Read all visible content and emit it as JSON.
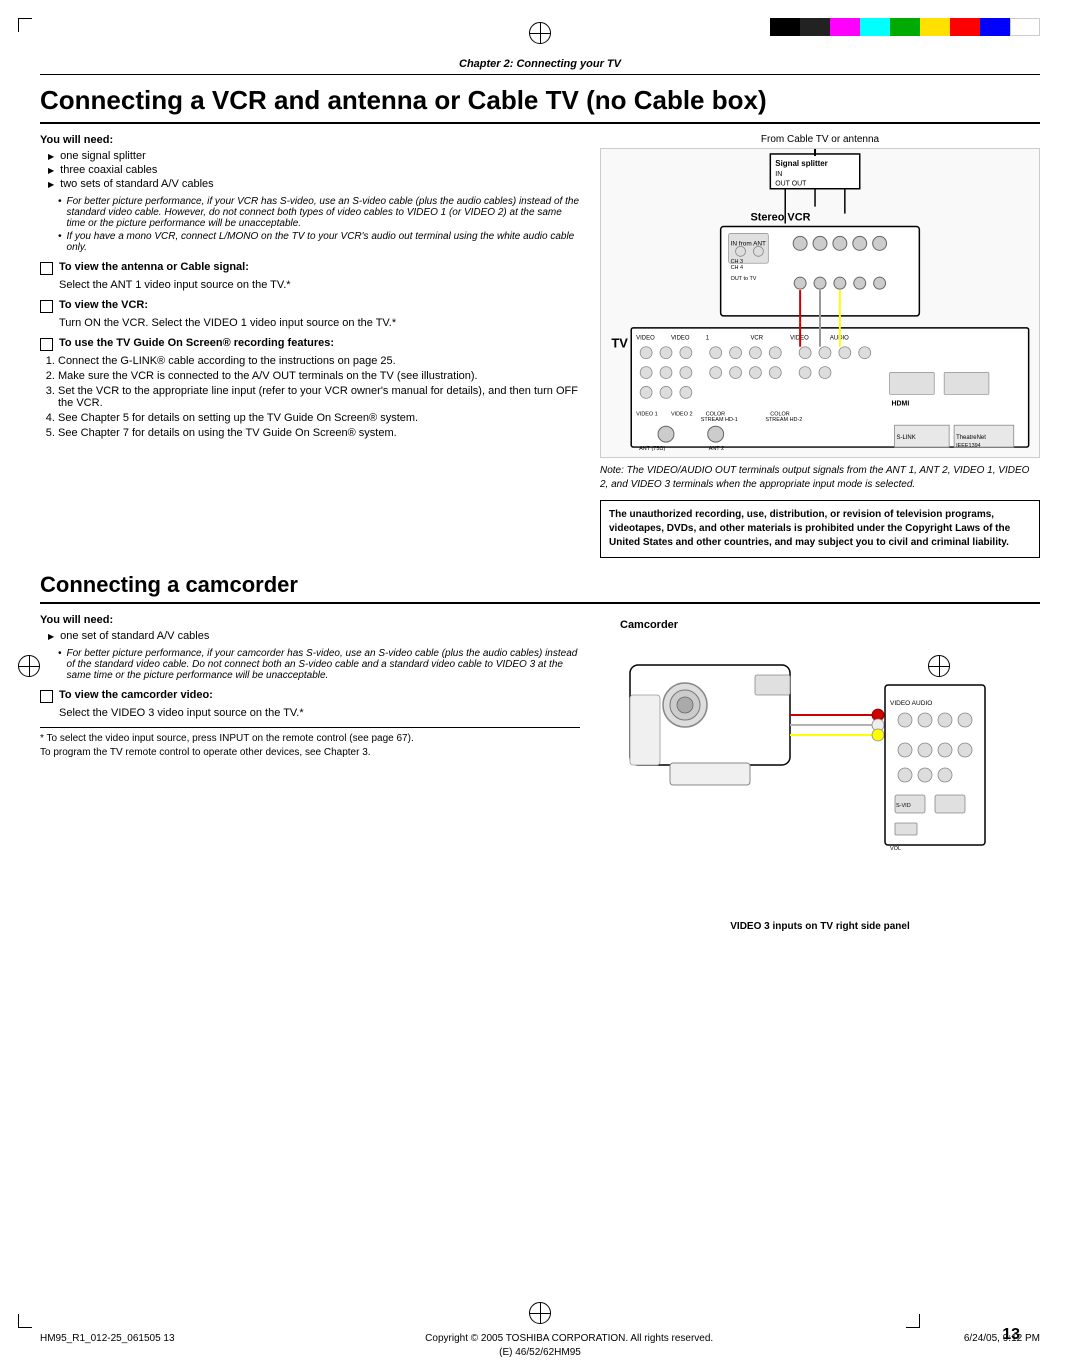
{
  "page": {
    "chapter_header": "Chapter 2: Connecting your TV",
    "section1": {
      "title": "Connecting a VCR and antenna or Cable TV (no Cable box)",
      "you_will_need_label": "You will need:",
      "bullets": [
        "one signal splitter",
        "three coaxial cables",
        "two sets of standard A/V cables"
      ],
      "sub_bullets": [
        "For better picture performance, if your VCR has S-video, use an S-video cable (plus the audio cables) instead of the standard video cable. However, do not connect both types of video cables to VIDEO 1 (or VIDEO 2) at the same time or the picture performance will be unacceptable.",
        "If you have a mono VCR, connect L/MONO on the TV to your VCR's audio out terminal using the white audio cable only."
      ],
      "checkbox1_label": "To view the antenna or Cable signal:",
      "checkbox1_desc": "Select the ANT 1 video input source on the TV.*",
      "checkbox2_label": "To view the VCR:",
      "checkbox2_desc": "Turn ON the VCR. Select the VIDEO 1 video input source on the TV.*",
      "checkbox3_label": "To use the TV Guide On Screen® recording features:",
      "numbered_steps": [
        "Connect the G-LINK® cable according to the instructions on page 25.",
        "Make sure the VCR is connected to the A/V OUT terminals on the TV (see illustration).",
        "Set the VCR to the appropriate line input (refer to your VCR owner's manual for details), and then turn OFF the VCR.",
        "See Chapter 5 for details on setting up the TV Guide On Screen® system.",
        "See Chapter 7 for details on using the TV Guide On Screen® system."
      ],
      "diagram_label_from": "From Cable TV or antenna",
      "diagram_label_signal": "Signal splitter",
      "diagram_label_vcr": "Stereo VCR",
      "diagram_label_tv": "TV",
      "note_text": "Note: The VIDEO/AUDIO OUT terminals output signals from the ANT 1, ANT 2, VIDEO 1, VIDEO 2, and VIDEO 3 terminals when the appropriate input mode is selected.",
      "warning_text": "The unauthorized recording, use, distribution, or revision of television programs, videotapes, DVDs, and other materials is prohibited under the Copyright Laws of the United States and other countries, and may subject you to civil and criminal liability."
    },
    "section2": {
      "title": "Connecting a camcorder",
      "you_will_need_label": "You will need:",
      "bullets": [
        "one set of standard A/V cables"
      ],
      "sub_bullets": [
        "For better picture performance, if your camcorder has S-video, use an S-video cable (plus the audio cables) instead of the standard video cable. Do not connect both an S-video cable and a standard video cable to VIDEO 3 at the same time or the picture performance will be unacceptable."
      ],
      "checkbox_label": "To view the camcorder video:",
      "checkbox_desc": "Select the VIDEO 3 video input source on the TV.*",
      "diagram_label": "Camcorder",
      "diagram_caption": "VIDEO 3 inputs on TV right side panel"
    },
    "footnote": {
      "line1": "* To select the video input source, press INPUT on the remote control (see page 67).",
      "line2": "  To program the TV remote control to operate other devices, see Chapter 3."
    },
    "footer": {
      "left": "HM95_R1_012-25_061505          13",
      "center": "Copyright © 2005 TOSHIBA CORPORATION. All rights reserved.",
      "right": "6/24/05, 9:12 PM",
      "page_number": "13",
      "bottom_model": "(E) 46/52/62HM95"
    }
  }
}
